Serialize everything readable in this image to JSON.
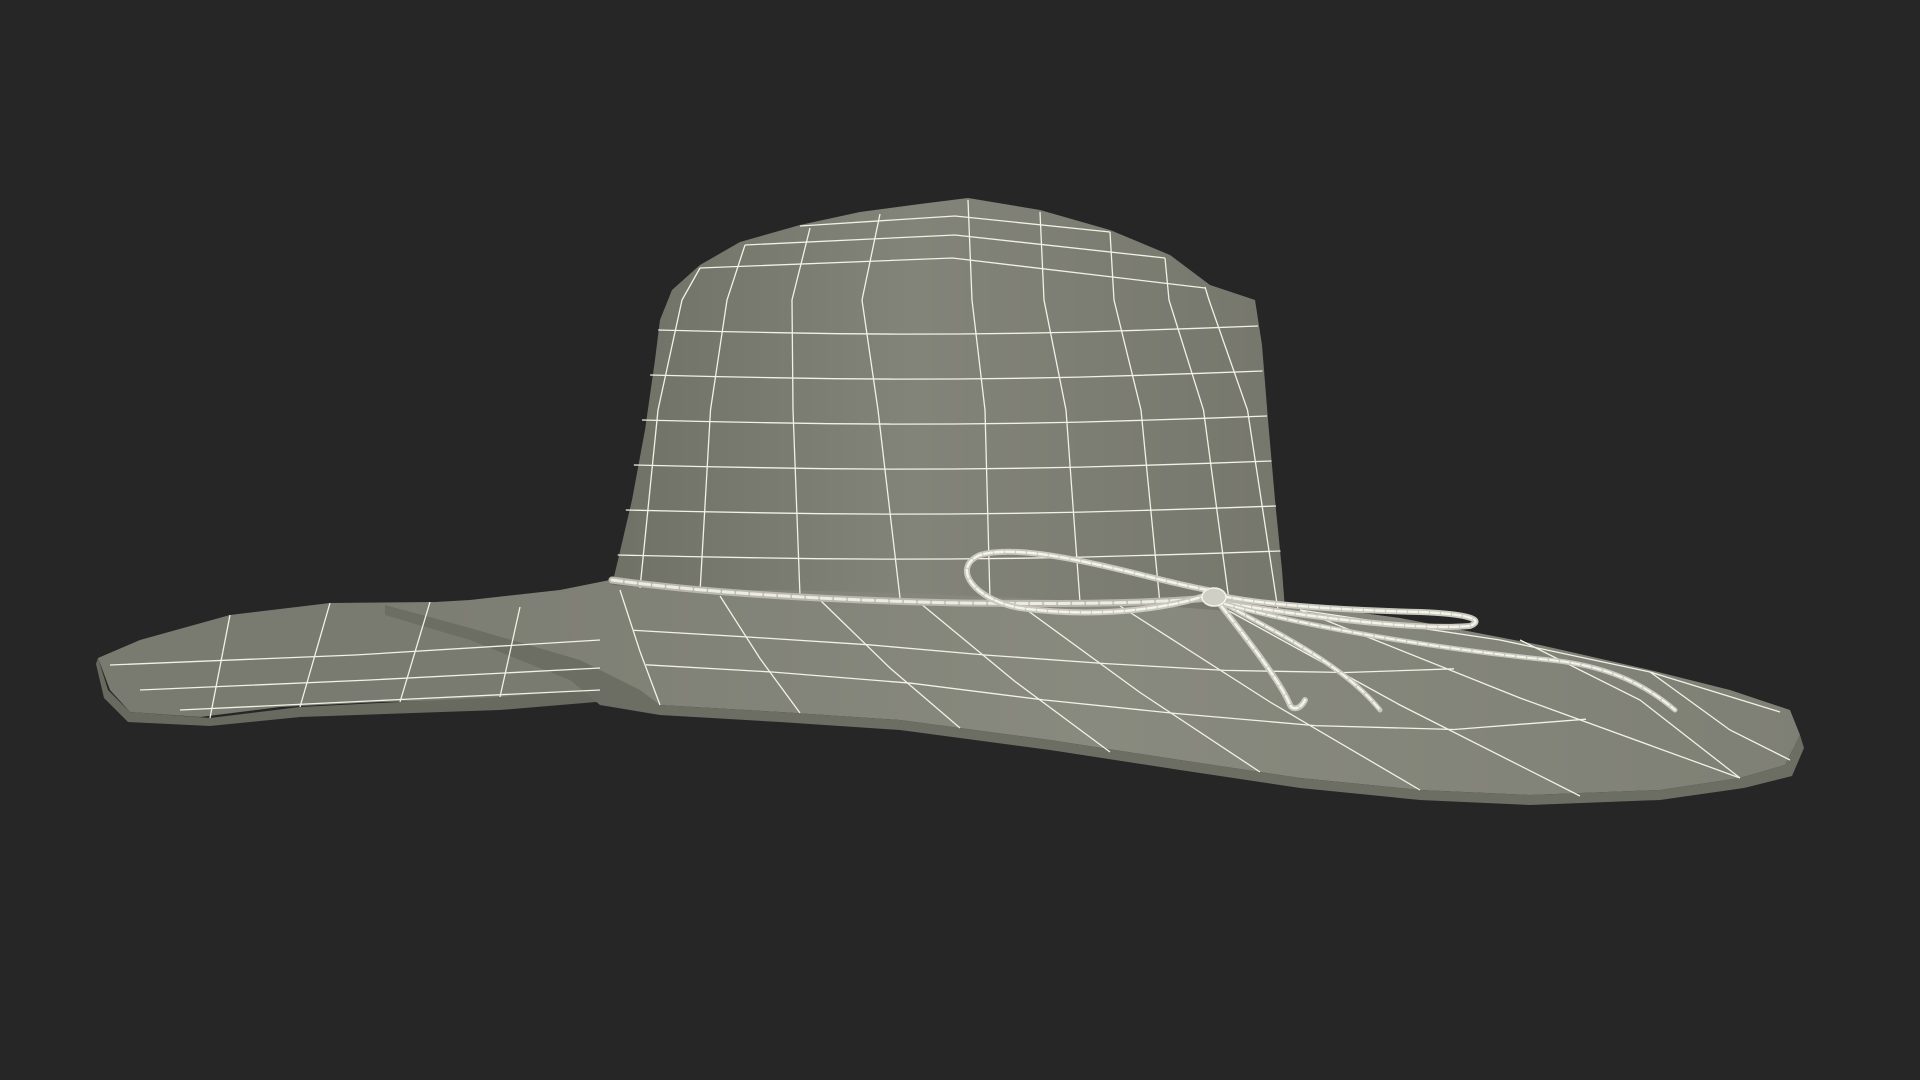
{
  "scene": {
    "background_color": "#262626",
    "surface_color": "#7f8075",
    "surface_light_color": "#8e8f84",
    "surface_dark_color": "#6e6f64",
    "wire_color": "#f1f1e6",
    "cord_color": "#d9d9cf",
    "subject_icon": "wide-brim-sun-hat-wireframe"
  }
}
